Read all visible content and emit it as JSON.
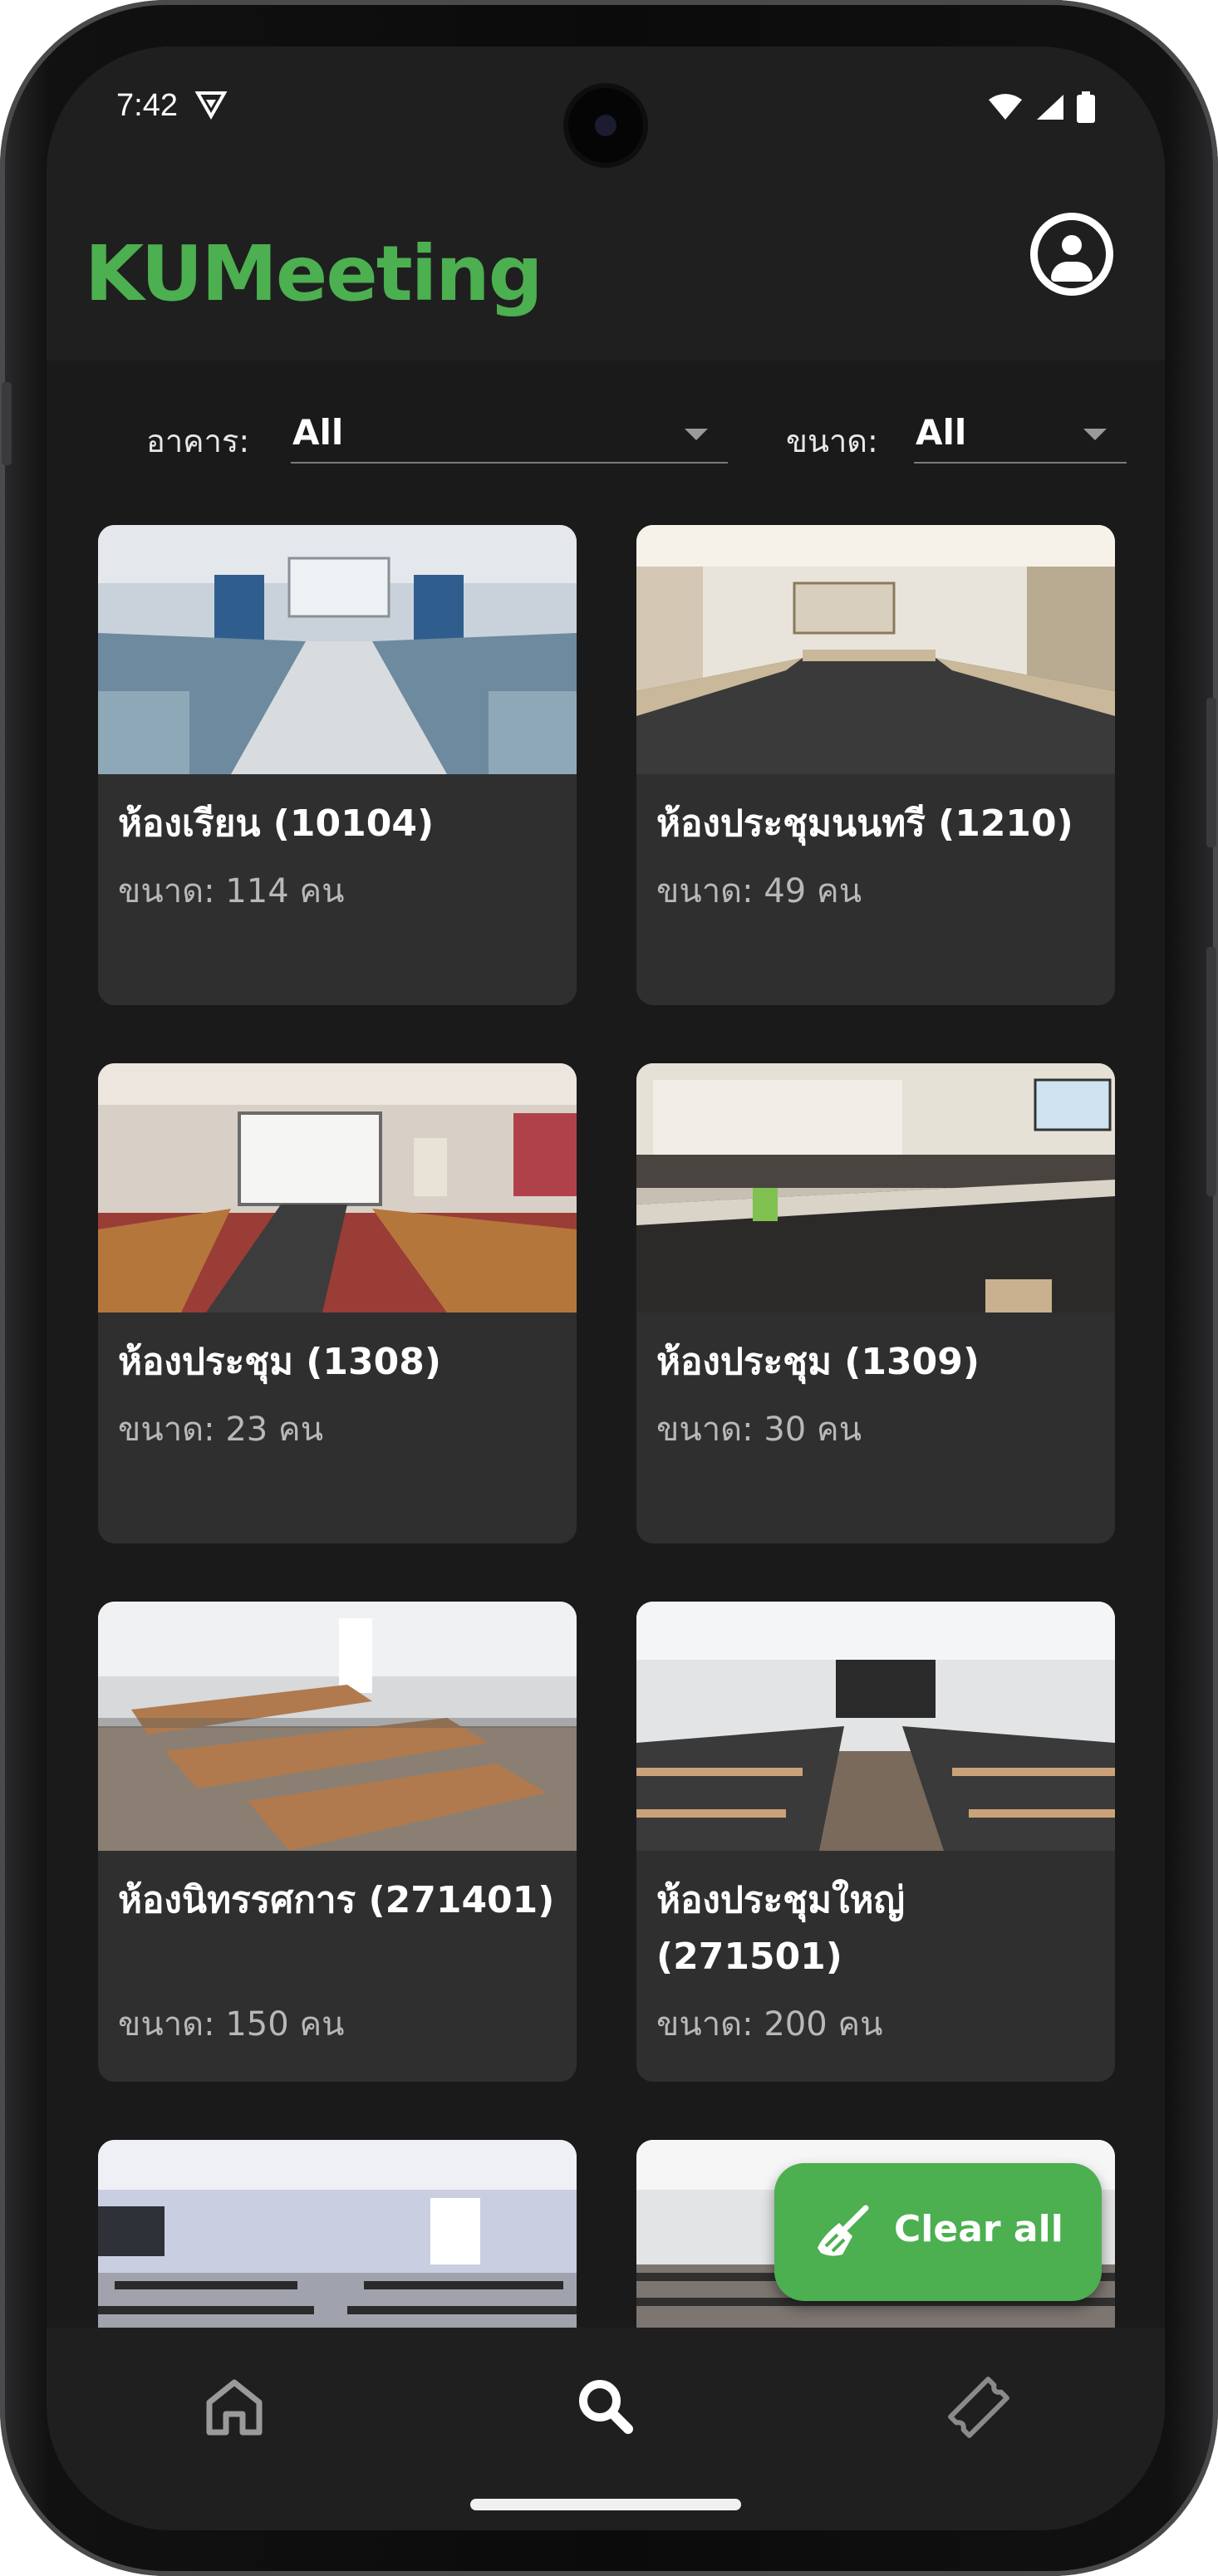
{
  "status_bar": {
    "time": "7:42"
  },
  "header": {
    "title": "KUMeeting"
  },
  "filters": {
    "building_label": "อาคาร:",
    "building_value": "All",
    "size_label": "ขนาด:",
    "size_value": "All"
  },
  "rooms": [
    {
      "name": "ห้องเรียน (10104)",
      "capacity": "ขนาด: 114 คน"
    },
    {
      "name": "ห้องประชุมนนทรี (1210)",
      "capacity": "ขนาด: 49 คน"
    },
    {
      "name": "ห้องประชุม (1308)",
      "capacity": "ขนาด: 23 คน"
    },
    {
      "name": "ห้องประชุม (1309)",
      "capacity": "ขนาด: 30 คน"
    },
    {
      "name": "ห้องนิทรรศการ (271401)",
      "capacity": "ขนาด: 150 คน"
    },
    {
      "name": "ห้องประชุมใหญ่ (271501)",
      "capacity": "ขนาด: 200 คน"
    }
  ],
  "fab": {
    "label": "Clear all"
  },
  "bottom_nav": {
    "items": [
      "home-icon",
      "search-icon",
      "ticket-icon"
    ],
    "active": "search-icon"
  },
  "colors": {
    "accent": "#4caf50",
    "background": "#1a1a1b",
    "card": "#2f2f30"
  }
}
